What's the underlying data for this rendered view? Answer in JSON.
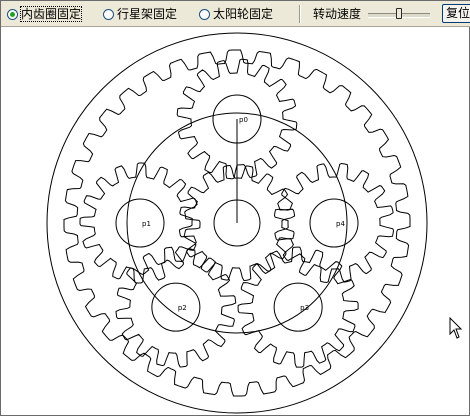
{
  "toolbar": {
    "modes": [
      {
        "label": "内齿圈固定",
        "selected": true
      },
      {
        "label": "行星架固定",
        "selected": false
      },
      {
        "label": "太阳轮固定",
        "selected": false
      }
    ],
    "speed_label": "转动速度",
    "speed_level": 0.5,
    "reset_label": "复位"
  },
  "gears": {
    "sun_label": "",
    "planets": [
      {
        "label": "p0"
      },
      {
        "label": "p1"
      },
      {
        "label": "p2"
      },
      {
        "label": "p3"
      },
      {
        "label": "p4"
      }
    ],
    "colors": {
      "line": "#000000",
      "background": "#ffffff"
    }
  }
}
